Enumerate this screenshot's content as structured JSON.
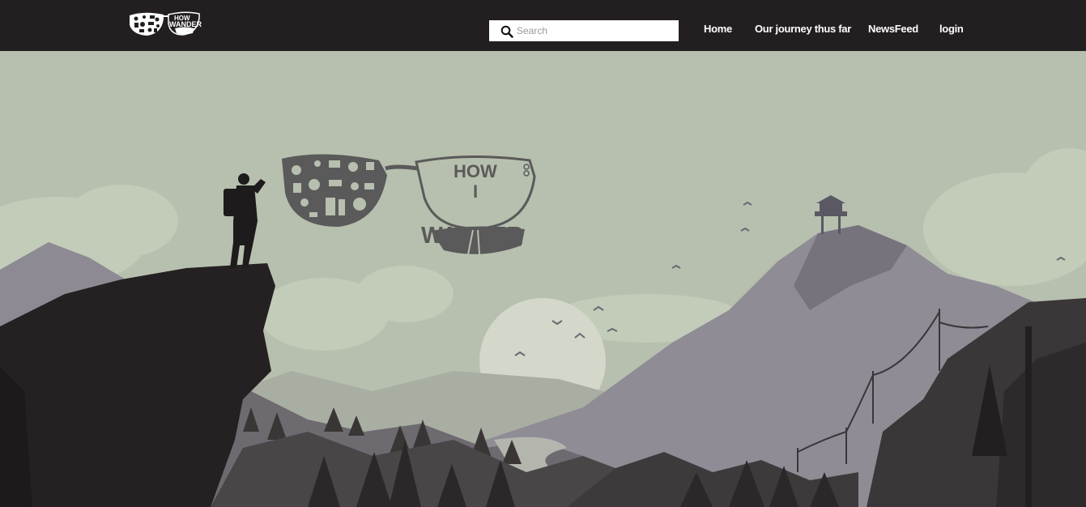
{
  "header": {
    "logo_alt": "How I Wander",
    "search": {
      "placeholder": "Search",
      "value": "",
      "icon": "search-icon"
    },
    "nav": [
      {
        "label": "Home"
      },
      {
        "label": "Our journey thus far"
      },
      {
        "label": "NewsFeed"
      },
      {
        "label": "login"
      }
    ]
  },
  "hero": {
    "logo_text": {
      "line1": "HOW",
      "line2": "I",
      "line3": "WANDER"
    }
  },
  "colors": {
    "topbar": "#231f20",
    "sky": "#b7bfae",
    "nav_text": "#ffffff",
    "logo_gray": "#5a5a5a"
  }
}
